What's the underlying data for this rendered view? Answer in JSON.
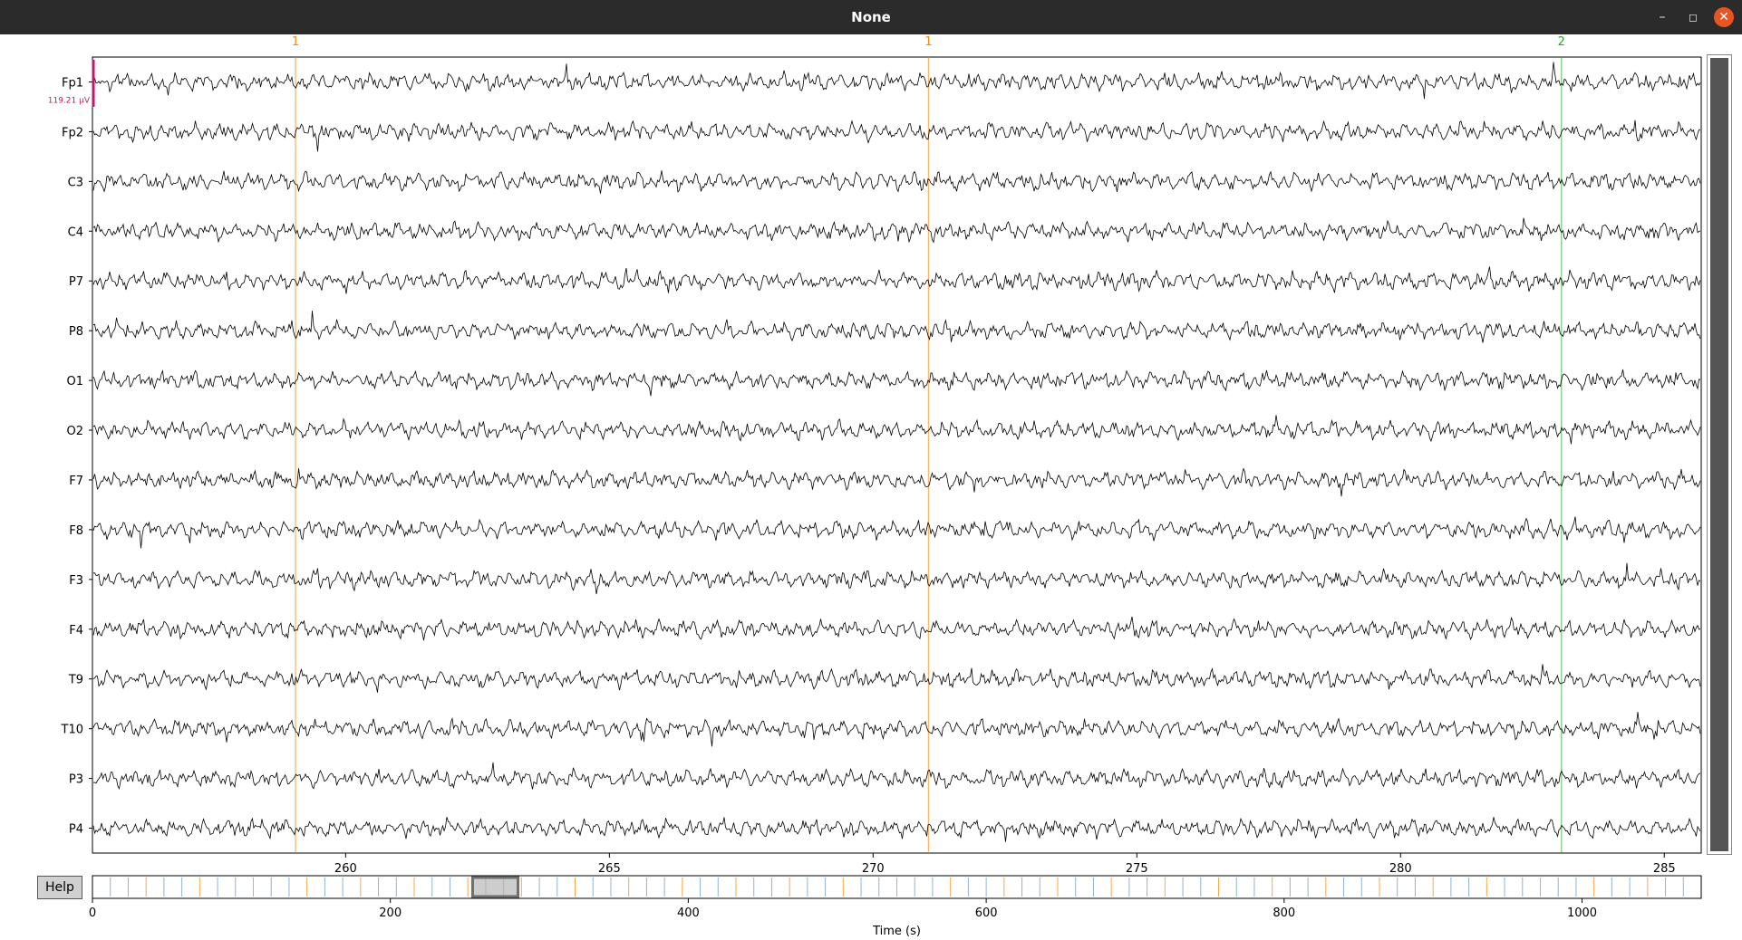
{
  "window": {
    "title": "None",
    "minimize_glyph": "–",
    "maximize_glyph": "◻",
    "close_glyph": "✕"
  },
  "help_label": "Help",
  "colors": {
    "titlebar_bg": "#2b2b2b",
    "close_button": "#e95420",
    "trace": "#000000",
    "event_1": "#ff8800",
    "event_2": "#22aa22",
    "scalebar": "#c0186a",
    "overview_tick": "#6a9ac8"
  },
  "scale_bar": {
    "label": "119.21 µV"
  },
  "channels": [
    "Fp1",
    "Fp2",
    "C3",
    "C4",
    "P7",
    "P8",
    "O1",
    "O2",
    "F7",
    "F8",
    "F3",
    "F4",
    "T9",
    "T10",
    "P3",
    "P4"
  ],
  "main_axis": {
    "xlim": [
      255.2,
      285.7
    ],
    "ticks": [
      260,
      265,
      270,
      275,
      280,
      285
    ]
  },
  "events": [
    {
      "time": 259.05,
      "label": "1",
      "color": "#ff8800"
    },
    {
      "time": 271.05,
      "label": "1",
      "color": "#ff8800"
    },
    {
      "time": 283.05,
      "label": "2",
      "color": "#22aa22"
    }
  ],
  "overview": {
    "xlim": [
      0,
      1080
    ],
    "ticks": [
      0,
      200,
      400,
      600,
      800,
      1000
    ],
    "xlabel": "Time (s)",
    "view_window": [
      255.2,
      285.7
    ],
    "event_interval_s": 12
  }
}
